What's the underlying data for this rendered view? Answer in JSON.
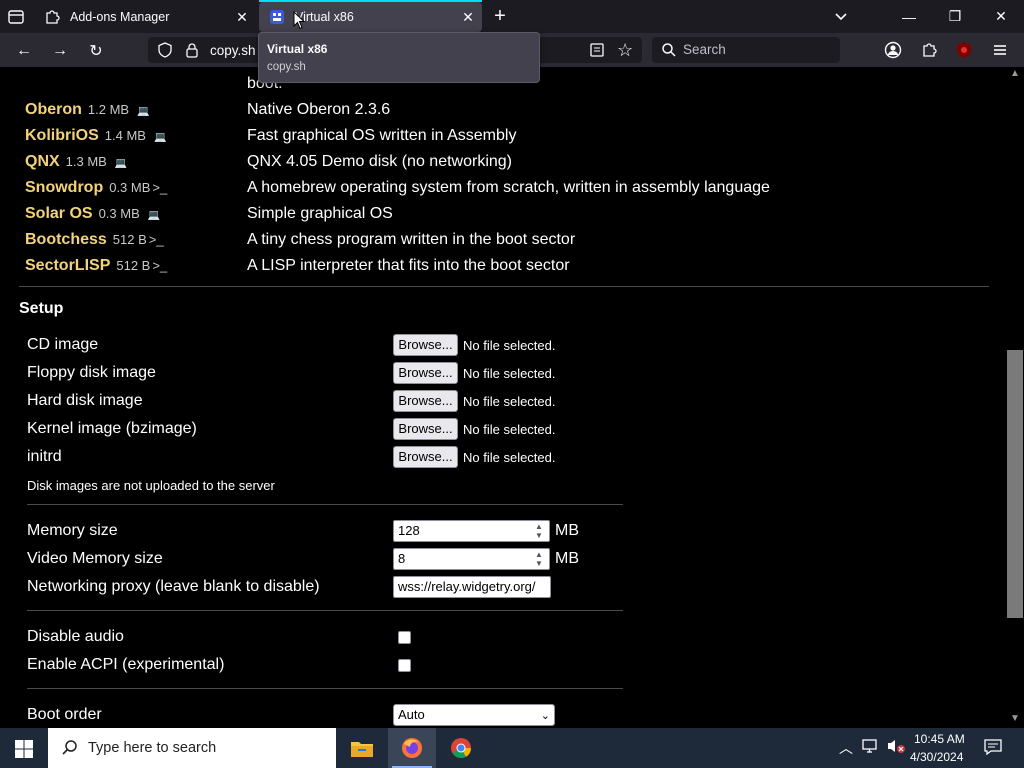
{
  "browser": {
    "tabs": [
      {
        "title": "Add-ons Manager",
        "favicon": "puzzle-icon"
      },
      {
        "title": "Virtual x86",
        "favicon": "v86-icon",
        "active": true
      }
    ],
    "url": "copy.sh",
    "search_placeholder": "Search",
    "tooltip": {
      "title": "Virtual x86",
      "subtitle": "copy.sh"
    }
  },
  "os_list": [
    {
      "name": "Oberon",
      "size": "1.2 MB",
      "kind": "laptop",
      "glyph": "💻",
      "desc": "Native Oberon 2.3.6"
    },
    {
      "name": "KolibriOS",
      "size": "1.4 MB",
      "kind": "laptop",
      "glyph": "💻",
      "desc": "Fast graphical OS written in Assembly"
    },
    {
      "name": "QNX",
      "size": "1.3 MB",
      "kind": "laptop",
      "glyph": "💻",
      "desc": "QNX 4.05 Demo disk (no networking)"
    },
    {
      "name": "Snowdrop",
      "size": "0.3 MB",
      "kind": "terminal",
      "glyph": ">_",
      "desc": "A homebrew operating system from scratch, written in assembly language"
    },
    {
      "name": "Solar OS",
      "size": "0.3 MB",
      "kind": "laptop",
      "glyph": "💻",
      "desc": "Simple graphical OS"
    },
    {
      "name": "Bootchess",
      "size": "512 B",
      "kind": "terminal",
      "glyph": ">_",
      "desc": "A tiny chess program written in the boot sector"
    },
    {
      "name": "SectorLISP",
      "size": "512 B",
      "kind": "terminal",
      "glyph": ">_",
      "desc": "A LISP interpreter that fits into the boot sector"
    }
  ],
  "partial_top_text": "boot.",
  "setup": {
    "heading": "Setup",
    "browse_label": "Browse...",
    "no_file": "No file selected.",
    "files": [
      "CD image",
      "Floppy disk image",
      "Hard disk image",
      "Kernel image (bzimage)",
      "initrd"
    ],
    "note": "Disk images are not uploaded to the server",
    "memory_label": "Memory size",
    "memory_value": "128",
    "vmem_label": "Video Memory size",
    "vmem_value": "8",
    "unit": "MB",
    "proxy_label": "Networking proxy (leave blank to disable)",
    "proxy_value": "wss://relay.widgetry.org/",
    "audio_label": "Disable audio",
    "acpi_label": "Enable ACPI (experimental)",
    "boot_label": "Boot order",
    "boot_value": "Auto"
  },
  "taskbar": {
    "search_placeholder": "Type here to search",
    "time": "10:45 AM",
    "date": "4/30/2024"
  }
}
